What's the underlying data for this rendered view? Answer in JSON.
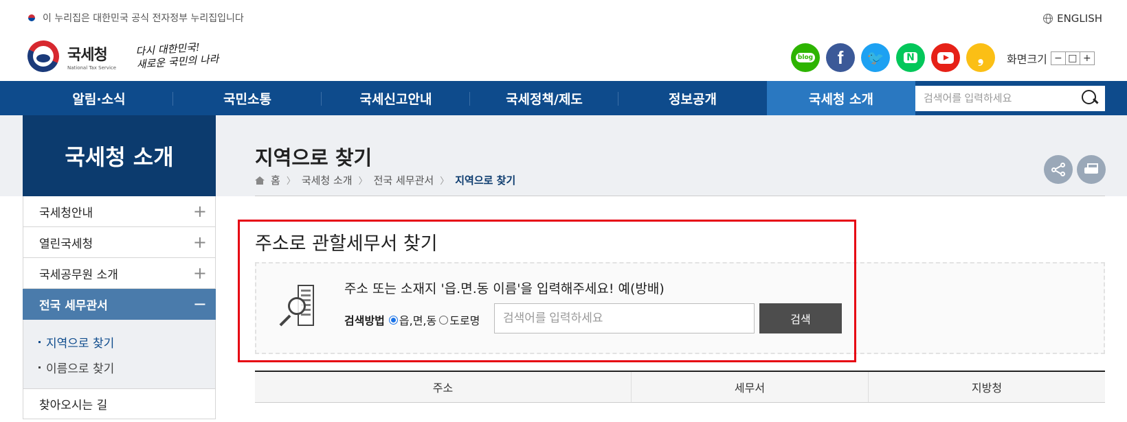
{
  "gov_bar": {
    "text": "이 누리집은 대한민국 공식 전자정부 누리집입니다"
  },
  "lang_link": "ENGLISH",
  "logo": {
    "ko": "국세청",
    "en": "National Tax Service"
  },
  "slogan": {
    "line1": "다시 대한민국!",
    "line2": "새로운 국민의 나라"
  },
  "sns": [
    "blog",
    "f",
    "t",
    "N",
    "youtube",
    "story"
  ],
  "zoom": {
    "label": "화면크기",
    "minus": "−",
    "reset": "□",
    "plus": "+"
  },
  "gnb": {
    "items": [
      "알림·소식",
      "국민소통",
      "국세신고안내",
      "국세정책/제도",
      "정보공개",
      "국세청 소개"
    ],
    "active_index": 5,
    "search_placeholder": "검색어를 입력하세요"
  },
  "lnb": {
    "title": "국세청 소개",
    "items": [
      {
        "label": "국세청안내",
        "toggle": "+"
      },
      {
        "label": "열린국세청",
        "toggle": "+"
      },
      {
        "label": "국세공무원 소개",
        "toggle": "+"
      },
      {
        "label": "전국 세무관서",
        "toggle": "−"
      }
    ],
    "sub_items": [
      "지역으로 찾기",
      "이름으로 찾기"
    ],
    "last_item": "찾아오시는 길"
  },
  "page": {
    "title": "지역으로 찾기",
    "breadcrumb": [
      "홈",
      "국세청 소개",
      "전국 세무관서",
      "지역으로 찾기"
    ]
  },
  "search_box": {
    "title": "주소로 관할세무서 찾기",
    "instruction": "주소 또는 소재지 '읍.면.동 이름'을 입력해주세요! 예(방배)",
    "method_label": "검색방법",
    "option1": "읍,면,동",
    "option2": "도로명",
    "selected": "읍,면,동",
    "input_placeholder": "검색어를 입력하세요",
    "button": "검색"
  },
  "table": {
    "headers": [
      "주소",
      "세무서",
      "지방청"
    ]
  },
  "colors": {
    "nav": "#0e4b8c",
    "nav_active": "#2a78c1",
    "lnb_title": "#0c3b6e",
    "highlight_border": "#e60012"
  }
}
